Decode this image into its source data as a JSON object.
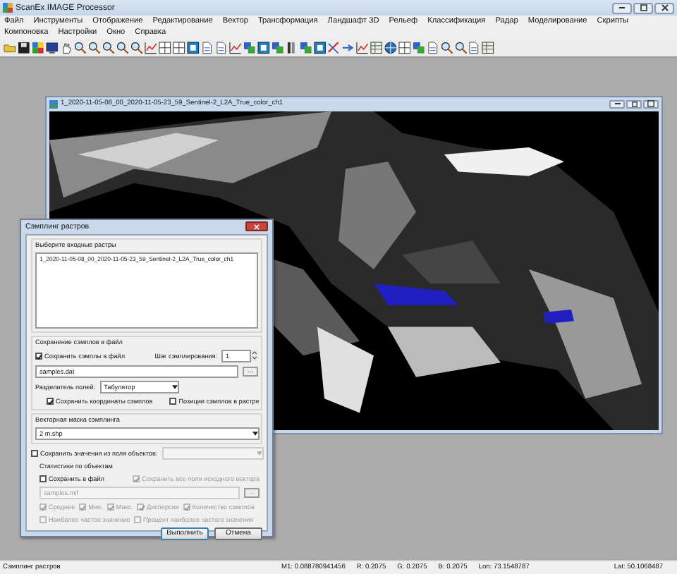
{
  "app": {
    "title": "ScanEx IMAGE Processor"
  },
  "menu": [
    "Файл",
    "Инструменты",
    "Отображение",
    "Редактирование",
    "Вектор",
    "Трансформация",
    "Ландшафт 3D",
    "Рельеф",
    "Классификация",
    "Радар",
    "Моделирование",
    "Скрипты",
    "Компоновка",
    "Настройки",
    "Окно",
    "Справка"
  ],
  "image_window": {
    "title": "1_2020-11-05-08_00_2020-11-05-23_59_Sentinel-2_L2A_True_color_ch1"
  },
  "dialog": {
    "title": "Сэмплинг растров",
    "input_group": {
      "label": "Выберите входные растры",
      "items": [
        "1_2020-11-05-08_00_2020-11-05-23_59_Sentinel-2_L2A_True_color_ch1"
      ]
    },
    "save_group": {
      "label": "Сохранение сэмплов в файл",
      "save_samples": {
        "label": "Сохранить сэмплы в файл",
        "checked": true
      },
      "step_label": "Шаг сэмплирования:",
      "step_value": "1",
      "file_value": "samples.dat",
      "browse": "...",
      "separator_label": "Разделитель полей:",
      "separator_value": "Табулятор",
      "options": [
        {
          "label": "Сохранить координаты сэмплов",
          "checked": true
        },
        {
          "label": "Позиции сэмплов в растре",
          "checked": false
        }
      ]
    },
    "mask_group": {
      "label": "Векторная маска сэмплинга",
      "value": "2 m.shp"
    },
    "field_values": {
      "label": "Сохранить значения из поля объектов:",
      "checked": false
    },
    "stats_group": {
      "label": "Статистики по объектам",
      "save_to_file": {
        "label": "Сохранить в файл",
        "checked": false,
        "disabled": false
      },
      "save_all_fields": {
        "label": "Сохранить все поля исходного вектора",
        "checked": true,
        "disabled": true
      },
      "file_value": "samples.mif",
      "file_disabled": true,
      "browse": "...",
      "options": [
        {
          "label": "Среднее",
          "checked": true,
          "disabled": true
        },
        {
          "label": "Мин.",
          "checked": true,
          "disabled": true
        },
        {
          "label": "Макс.",
          "checked": true,
          "disabled": true
        },
        {
          "label": "Дисперсия",
          "checked": true,
          "disabled": true
        },
        {
          "label": "Количество сэмплов",
          "checked": true,
          "disabled": true
        }
      ],
      "options2": [
        {
          "label": "Наиболее частое значение",
          "checked": false,
          "disabled": true
        },
        {
          "label": "Процент наиболее частого значения",
          "checked": false,
          "disabled": true
        }
      ]
    },
    "buttons": [
      "Выполнить",
      "Отмена"
    ]
  },
  "status_bar": {
    "message": "Сэмплинг растров",
    "fields": [
      "M1: 0.088780941456",
      "R: 0.2075",
      "G: 0.2075",
      "B: 0.2075",
      "Lon: 73.1548787",
      "Lat: 50.1068487"
    ]
  }
}
